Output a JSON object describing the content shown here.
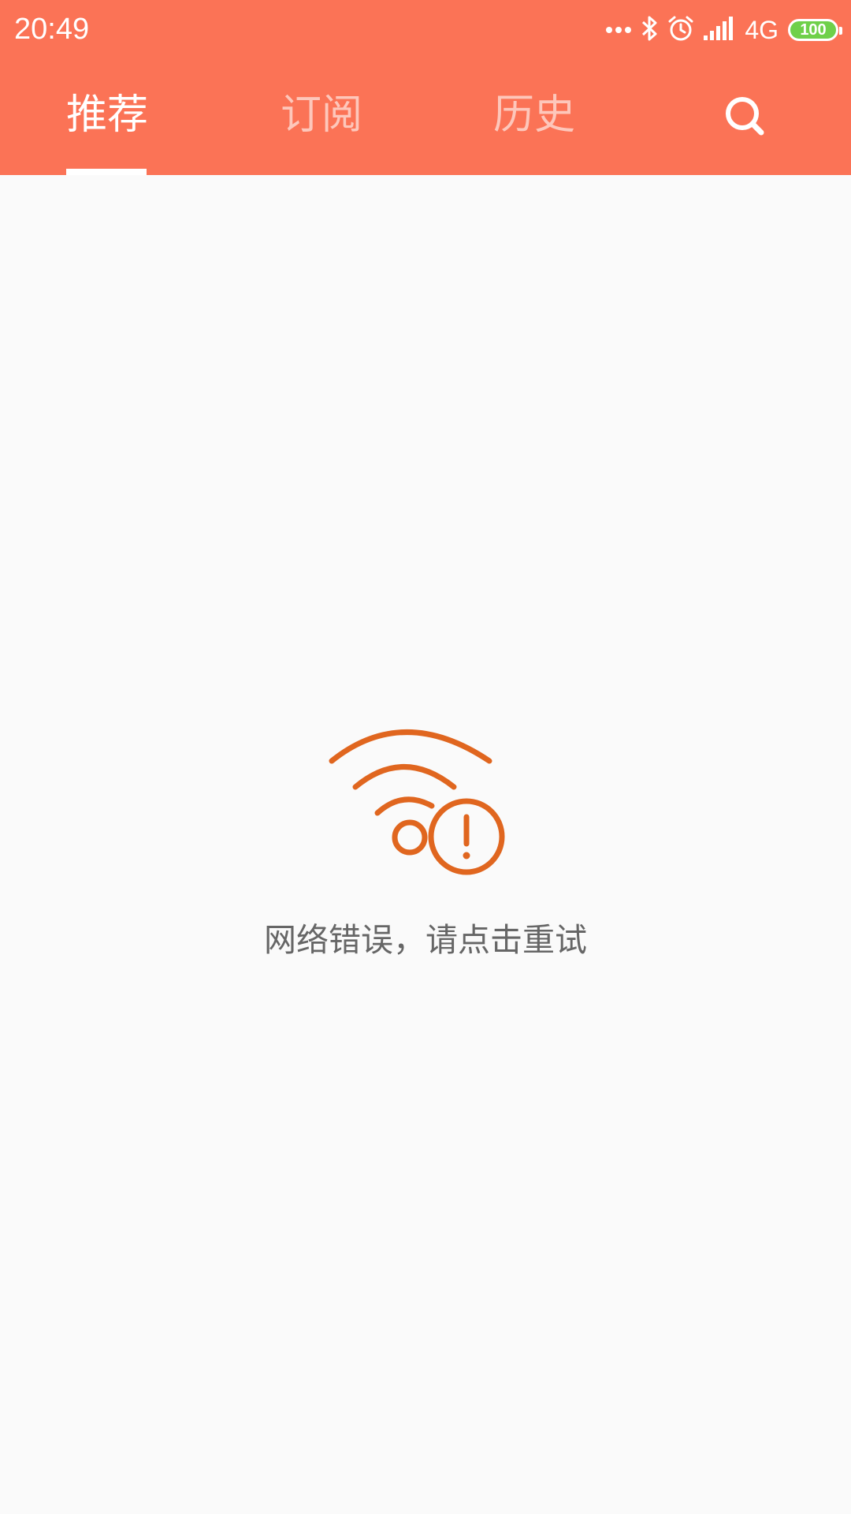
{
  "status_bar": {
    "time": "20:49",
    "network": "4G",
    "battery": "100",
    "icons": [
      "more-dots-icon",
      "bluetooth-icon",
      "alarm-icon",
      "signal-icon",
      "battery-icon"
    ]
  },
  "tabs": [
    {
      "label": "推荐",
      "active": true
    },
    {
      "label": "订阅",
      "active": false
    },
    {
      "label": "历史",
      "active": false
    }
  ],
  "search": {
    "icon": "search-icon"
  },
  "error": {
    "icon": "wifi-error-icon",
    "message": "网络错误，请点击重试"
  },
  "colors": {
    "header_bg": "#fb7356",
    "tab_active": "#ffffff",
    "tab_inactive": "#fdc7bb",
    "icon_accent": "#e0661f",
    "battery_fill": "#6fd04a",
    "page_bg": "#fafafa",
    "error_text": "#666666"
  }
}
